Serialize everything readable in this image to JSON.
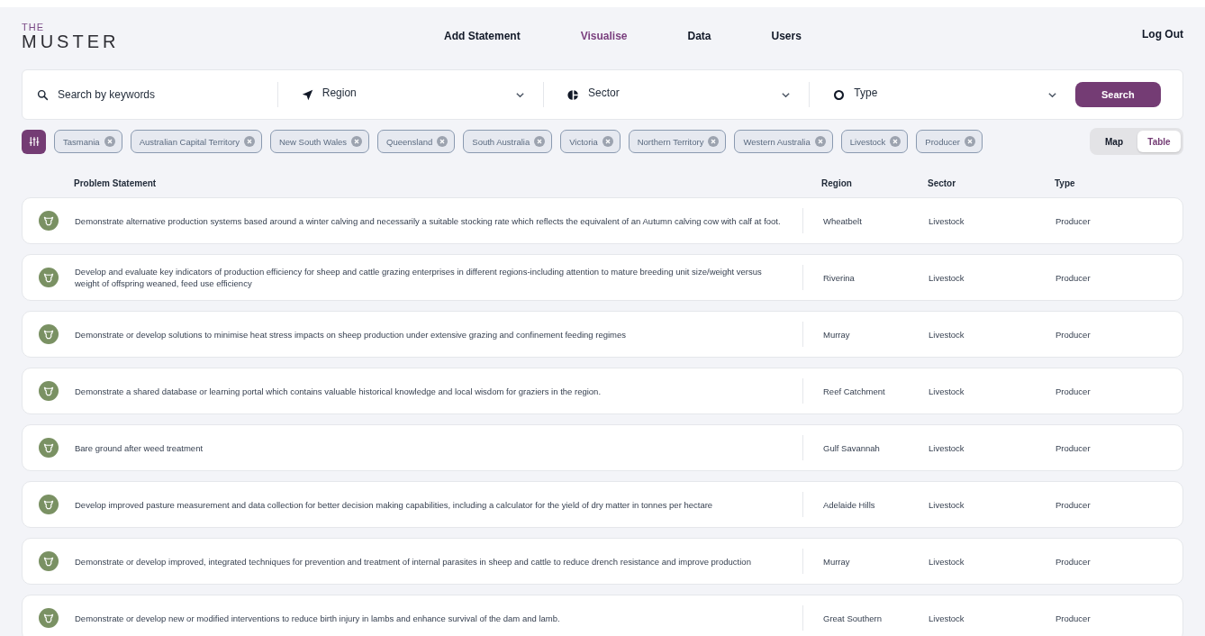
{
  "logo": {
    "small": "THE",
    "large": "MUSTER"
  },
  "nav": [
    {
      "label": "Add Statement",
      "selected": false
    },
    {
      "label": "Visualise",
      "selected": true
    },
    {
      "label": "Data",
      "selected": false
    },
    {
      "label": "Users",
      "selected": false
    }
  ],
  "logout": "Log Out",
  "search": {
    "placeholder": "Search by keywords",
    "filters": [
      {
        "kind": "region",
        "label": "Region"
      },
      {
        "kind": "sector",
        "label": "Sector"
      },
      {
        "kind": "type",
        "label": "Type"
      }
    ],
    "button": "Search"
  },
  "chips": [
    "Tasmania",
    "Australian Capital Territory",
    "New South Wales",
    "Queensland",
    "South Australia",
    "Victoria",
    "Northern Territory",
    "Western Australia",
    "Livestock",
    "Producer"
  ],
  "view_toggle": [
    {
      "label": "Map",
      "selected": false
    },
    {
      "label": "Table",
      "selected": true
    }
  ],
  "table": {
    "columns": [
      "Problem Statement",
      "Region",
      "Sector",
      "Type"
    ],
    "rows": [
      {
        "statement": "Demonstrate alternative production systems based around a winter calving and necessarily a suitable stocking rate which reflects the equivalent of an Autumn calving cow with calf at foot.",
        "region": "Wheatbelt",
        "sector": "Livestock",
        "type": "Producer"
      },
      {
        "statement": "Develop and evaluate key indicators of production efficiency for sheep and cattle grazing enterprises in different regions-including attention to mature breeding unit size/weight versus weight of offspring weaned, feed use efficiency",
        "region": "Riverina",
        "sector": "Livestock",
        "type": "Producer"
      },
      {
        "statement": "Demonstrate or develop solutions to minimise heat stress impacts on sheep production under extensive grazing and confinement feeding regimes",
        "region": "Murray",
        "sector": "Livestock",
        "type": "Producer"
      },
      {
        "statement": "Demonstrate a shared database or learning portal which contains valuable historical knowledge and local wisdom for graziers in the region.",
        "region": "Reef Catchment",
        "sector": "Livestock",
        "type": "Producer"
      },
      {
        "statement": "Bare ground after weed treatment",
        "region": "Gulf Savannah",
        "sector": "Livestock",
        "type": "Producer"
      },
      {
        "statement": "Develop improved pasture measurement and data collection for better decision making capabilities, including a calculator for the yield of dry matter in tonnes per hectare",
        "region": "Adelaide Hills",
        "sector": "Livestock",
        "type": "Producer"
      },
      {
        "statement": "Demonstrate or develop improved, integrated techniques for prevention and treatment of internal parasites in sheep and cattle to reduce drench resistance and improve production",
        "region": "Murray",
        "sector": "Livestock",
        "type": "Producer"
      },
      {
        "statement": "Demonstrate or develop new or modified interventions to reduce birth injury in lambs and enhance survival of the dam and lamb.",
        "region": "Great Southern",
        "sector": "Livestock",
        "type": "Producer"
      }
    ]
  }
}
